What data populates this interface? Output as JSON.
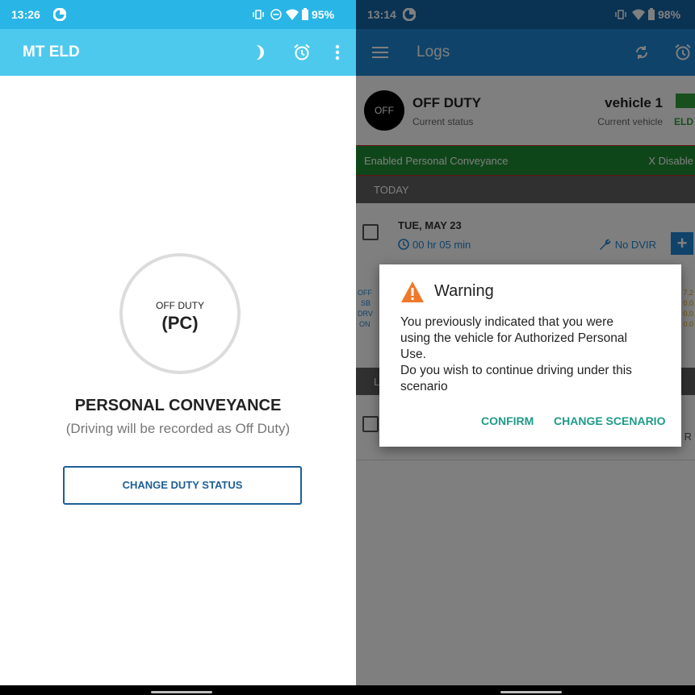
{
  "left": {
    "status": {
      "time": "13:26",
      "battery": "95%"
    },
    "app_title": "MT ELD",
    "circle": {
      "top": "OFF DUTY",
      "main": "(PC)"
    },
    "title": "PERSONAL CONVEYANCE",
    "subtitle": "(Driving will be recorded as Off Duty)",
    "button_label": "CHANGE DUTY STATUS"
  },
  "right": {
    "status": {
      "time": "13:14",
      "battery": "98%"
    },
    "app_title": "Logs",
    "duty": {
      "badge": "OFF",
      "label": "OFF DUTY",
      "sub": "Current status"
    },
    "vehicle": {
      "name": "vehicle 1",
      "sub": "Current vehicle",
      "eld": "ELD"
    },
    "pc_bar": {
      "enabled": "Enabled Personal Conveyance",
      "disable": "X Disable"
    },
    "today_header": "TODAY",
    "log": {
      "date": "TUE, MAY 23",
      "hours": "00 hr 05 min",
      "dvir": "No DVIR",
      "add": "+"
    },
    "stats": {
      "labels": [
        "OFF",
        "SB",
        "DRV",
        "ON"
      ],
      "values": [
        "7.2",
        "0.0",
        "0.0",
        "0.0"
      ]
    },
    "lower_header": "L",
    "lower_tail": "R",
    "dialog": {
      "title": "Warning",
      "lines": [
        "You previously indicated that you were",
        "using the vehicle for Authorized Personal",
        "Use.",
        "Do you wish to continue driving under this",
        "scenario"
      ],
      "confirm": "CONFIRM",
      "change": "CHANGE SCENARIO"
    }
  },
  "colors": {
    "left_statusbar": "#29b6e6",
    "left_appbar": "#4ec9ee",
    "right_appbar": "#1e86d2",
    "pc_green": "#1e8d33",
    "accent_teal": "#1e9a8a",
    "warning_orange": "#f0782a"
  },
  "icons": [
    "data-saver-icon",
    "wifi-icon",
    "battery-icon",
    "night-mode-icon",
    "alarm-icon",
    "more-vert-icon",
    "menu-icon",
    "sync-icon",
    "clock-icon",
    "wrench-icon",
    "warning-icon"
  ]
}
